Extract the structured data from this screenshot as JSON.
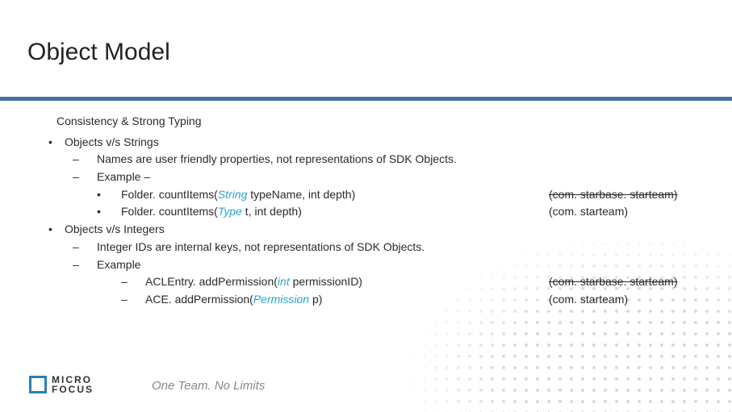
{
  "title": "Object Model",
  "subtitle": "Consistency & Strong Typing",
  "sections": [
    {
      "heading": "Objects v/s Strings",
      "lines": [
        "Names are user friendly properties, not representations of SDK Objects.",
        "Example –"
      ],
      "examples": [
        {
          "pre": "Folder. countItems(",
          "kw": "String",
          "post": " typeName, int depth)",
          "pkg": "(com. starbase. starteam)",
          "strike": true
        },
        {
          "pre": "Folder. countItems(",
          "kw": "Type",
          "post": " t, int depth)",
          "pkg": "(com. starteam)",
          "strike": false
        }
      ],
      "exBullet": "•"
    },
    {
      "heading": "Objects v/s Integers",
      "lines": [
        "Integer IDs are internal keys, not representations of SDK Objects.",
        "Example"
      ],
      "examples": [
        {
          "pre": "ACLEntry. addPermission(",
          "kw": "int",
          "post": " permissionID)",
          "pkg": "(com. starbase. starteam)",
          "strike": true
        },
        {
          "pre": "ACE. addPermission(",
          "kw": "Permission",
          "post": " p)",
          "pkg": "(com. starteam)",
          "strike": false
        }
      ],
      "exBullet": "–"
    }
  ],
  "logo": {
    "line1": "MICRO",
    "line2": "FOCUS"
  },
  "tagline": "One Team. No Limits"
}
